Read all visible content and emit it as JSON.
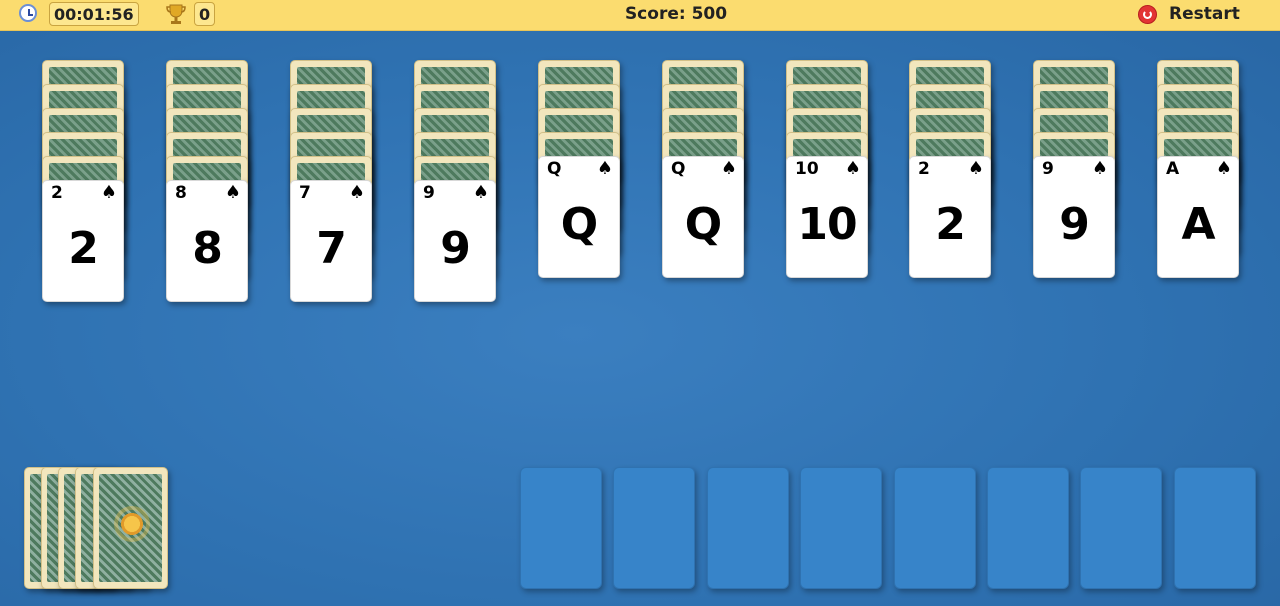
{
  "topbar": {
    "timer": "00:01:56",
    "wins": "0",
    "score": "Score: 500",
    "restart_label": "Restart"
  },
  "icons": {
    "timer": "clock-icon",
    "wins": "trophy-icon",
    "restart": "restart-icon"
  },
  "colors": {
    "topbar": "#fbdc6f",
    "table": "#2f72b2",
    "card_face": "#ffffff",
    "foundation_slot": "#3784c9"
  },
  "tableau": [
    {
      "facedown": 5,
      "rank": "2",
      "suit": "♠"
    },
    {
      "facedown": 5,
      "rank": "8",
      "suit": "♠"
    },
    {
      "facedown": 5,
      "rank": "7",
      "suit": "♠"
    },
    {
      "facedown": 5,
      "rank": "9",
      "suit": "♠"
    },
    {
      "facedown": 4,
      "rank": "Q",
      "suit": "♠"
    },
    {
      "facedown": 4,
      "rank": "Q",
      "suit": "♠"
    },
    {
      "facedown": 4,
      "rank": "10",
      "suit": "♠"
    },
    {
      "facedown": 4,
      "rank": "2",
      "suit": "♠"
    },
    {
      "facedown": 4,
      "rank": "9",
      "suit": "♠"
    },
    {
      "facedown": 4,
      "rank": "A",
      "suit": "♠"
    }
  ],
  "stock": {
    "piles": 5
  },
  "foundations": {
    "count": 8
  }
}
